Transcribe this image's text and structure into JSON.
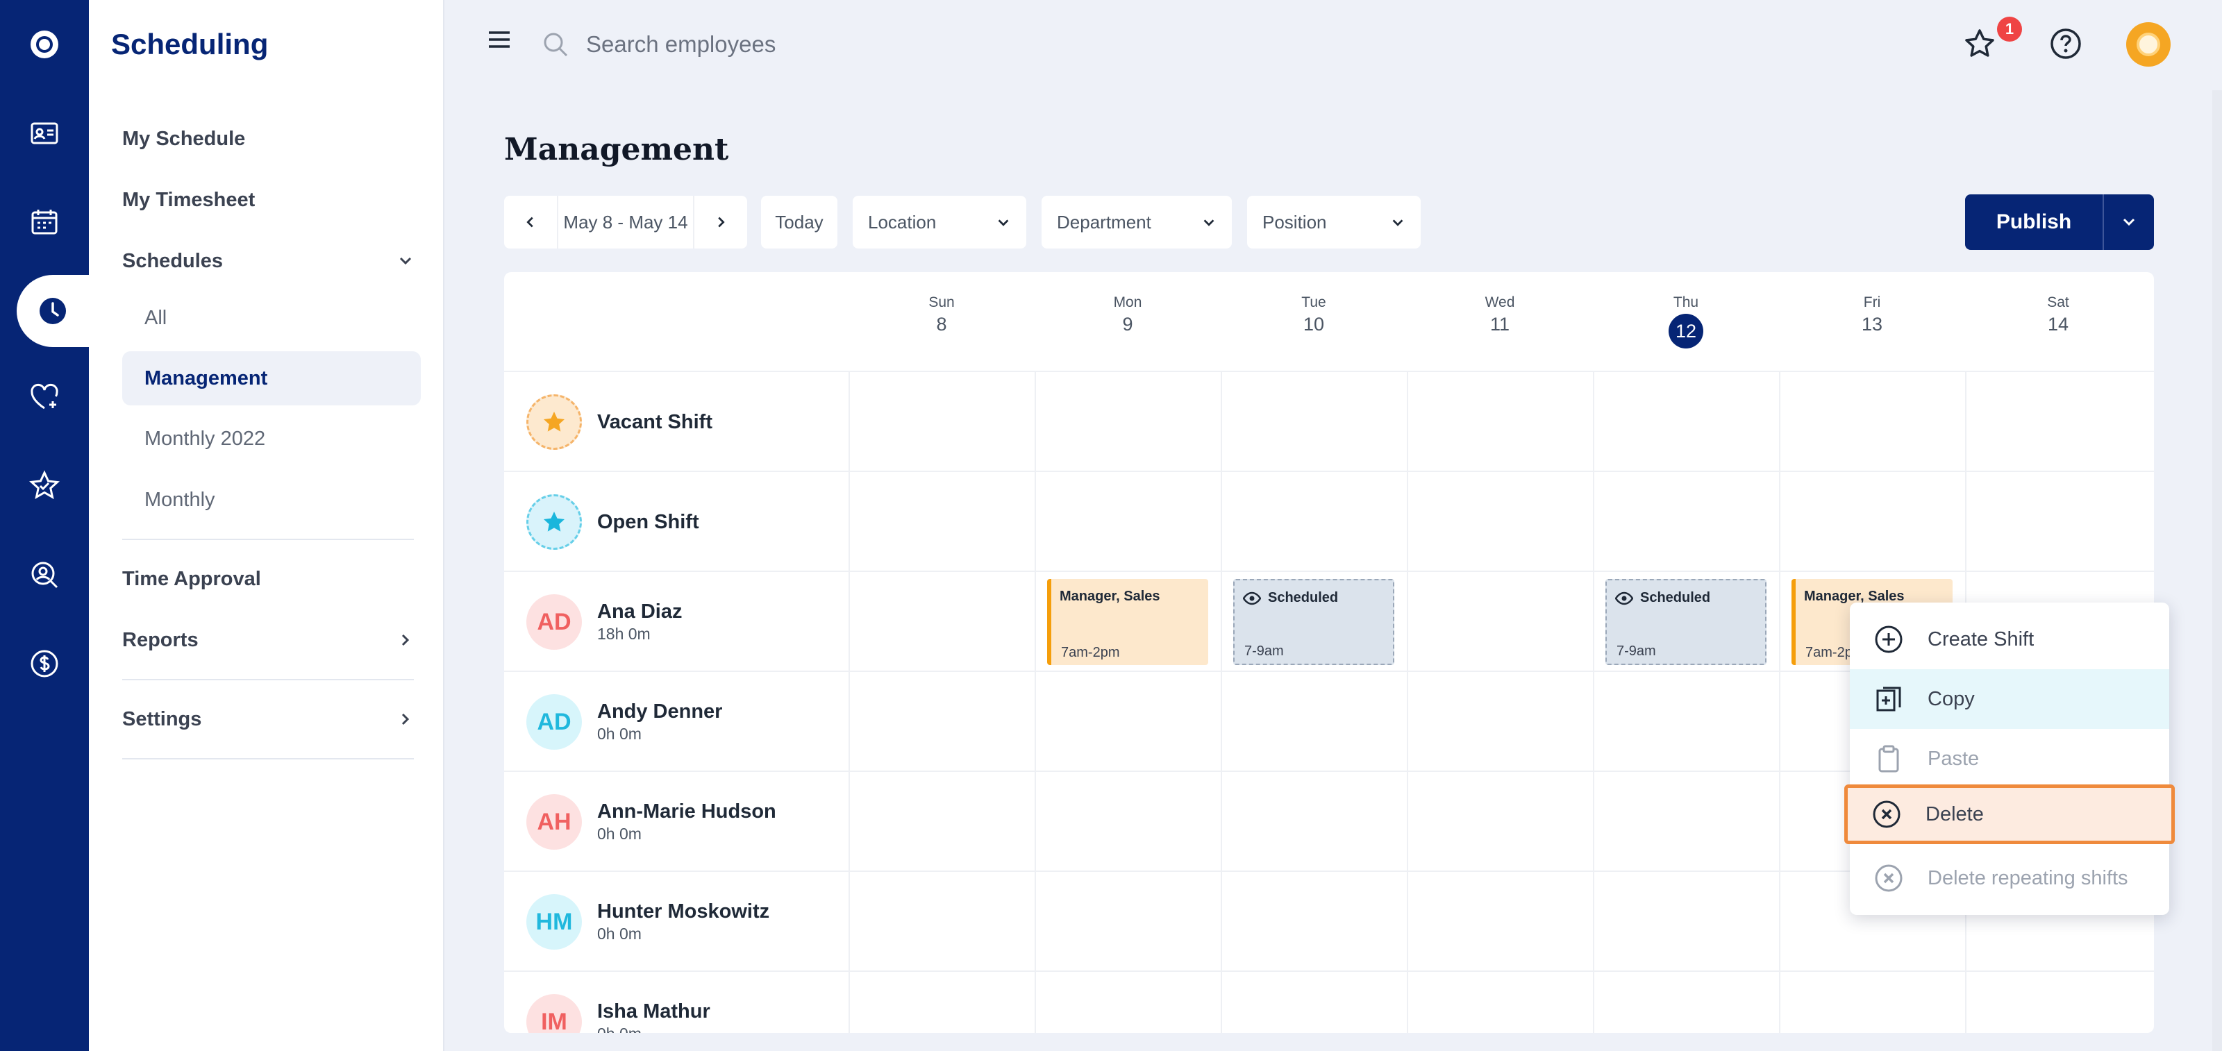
{
  "app": {
    "section_title": "Scheduling"
  },
  "sidebar": {
    "my_schedule": "My Schedule",
    "my_timesheet": "My Timesheet",
    "schedules": "Schedules",
    "sub_items": [
      "All",
      "Management",
      "Monthly 2022",
      "Monthly"
    ],
    "time_approval": "Time Approval",
    "reports": "Reports",
    "settings": "Settings"
  },
  "topbar": {
    "search_placeholder": "Search employees",
    "notification_count": "1"
  },
  "page": {
    "title": "Management"
  },
  "toolbar": {
    "date_range": "May 8 - May 14",
    "today": "Today",
    "location": "Location",
    "department": "Department",
    "position": "Position",
    "publish": "Publish"
  },
  "days": [
    {
      "dow": "Sun",
      "num": "8"
    },
    {
      "dow": "Mon",
      "num": "9"
    },
    {
      "dow": "Tue",
      "num": "10"
    },
    {
      "dow": "Wed",
      "num": "11"
    },
    {
      "dow": "Thu",
      "num": "12",
      "today": true
    },
    {
      "dow": "Fri",
      "num": "13"
    },
    {
      "dow": "Sat",
      "num": "14"
    }
  ],
  "rows": [
    {
      "name": "Vacant Shift",
      "hours": "",
      "initials": ""
    },
    {
      "name": "Open Shift",
      "hours": "",
      "initials": ""
    },
    {
      "name": "Ana Diaz",
      "hours": "18h 0m",
      "initials": "AD"
    },
    {
      "name": "Andy Denner",
      "hours": "0h 0m",
      "initials": "AD"
    },
    {
      "name": "Ann-Marie Hudson",
      "hours": "0h 0m",
      "initials": "AH"
    },
    {
      "name": "Hunter Moskowitz",
      "hours": "0h 0m",
      "initials": "HM"
    },
    {
      "name": "Isha Mathur",
      "hours": "0h 0m",
      "initials": "IM"
    }
  ],
  "shifts": [
    {
      "day": "Mon",
      "title": "Manager, Sales",
      "time": "7am-2pm",
      "kind": "sales"
    },
    {
      "day": "Tue",
      "title": "Scheduled",
      "time": "7-9am",
      "kind": "scheduled"
    },
    {
      "day": "Thu",
      "title": "Scheduled",
      "time": "7-9am",
      "kind": "scheduled"
    },
    {
      "day": "Fri",
      "title": "Manager, Sales",
      "time": "7am-2pm",
      "kind": "sales"
    }
  ],
  "context_menu": {
    "create": "Create Shift",
    "copy": "Copy",
    "paste": "Paste",
    "delete": "Delete",
    "delete_repeating": "Delete repeating shifts"
  },
  "colors": {
    "navy": "#062575",
    "accent_orange": "#ef8a3c",
    "today": "#062575"
  }
}
